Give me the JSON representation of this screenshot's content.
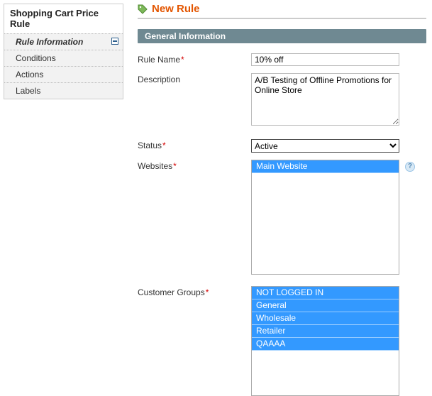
{
  "sidebar": {
    "title": "Shopping Cart Price Rule",
    "items": [
      {
        "label": "Rule Information",
        "active": true
      },
      {
        "label": "Conditions",
        "active": false
      },
      {
        "label": "Actions",
        "active": false
      },
      {
        "label": "Labels",
        "active": false
      }
    ]
  },
  "header": {
    "title": "New Rule"
  },
  "section": {
    "title": "General Information"
  },
  "form": {
    "rule_name": {
      "label": "Rule Name",
      "value": "10% off",
      "required": true
    },
    "description": {
      "label": "Description",
      "value": "A/B Testing of Offline Promotions for Online Store",
      "required": false
    },
    "status": {
      "label": "Status",
      "value": "Active",
      "required": true
    },
    "websites": {
      "label": "Websites",
      "required": true,
      "options": [
        {
          "label": "Main Website",
          "selected": true
        }
      ]
    },
    "customer_groups": {
      "label": "Customer Groups",
      "required": true,
      "options": [
        {
          "label": "NOT LOGGED IN",
          "selected": true
        },
        {
          "label": "General",
          "selected": true
        },
        {
          "label": "Wholesale",
          "selected": true
        },
        {
          "label": "Retailer",
          "selected": true
        },
        {
          "label": "QAAAA",
          "selected": true
        }
      ]
    }
  },
  "glyphs": {
    "required": "*",
    "help": "?"
  }
}
